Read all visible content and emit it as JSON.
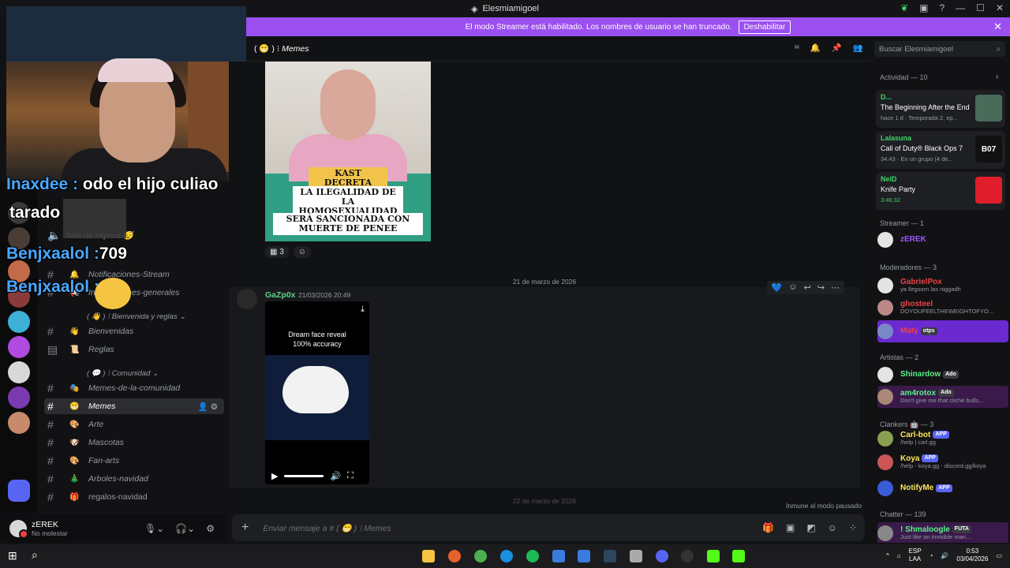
{
  "window": {
    "title": "Elesmiamigoel"
  },
  "streamer_banner": {
    "text": "El modo Streamer está habilitado. Los nombres de usuario se han truncado.",
    "button": "Deshabilitar"
  },
  "overlay_chat": [
    {
      "user": "Inaxdee :",
      "msg": "odo el hijo culiao"
    },
    {
      "user": "",
      "msg": "tarado"
    },
    {
      "user": "Benjxaalol :",
      "msg": "709"
    },
    {
      "user": "Benjxaalol :",
      "msg": ""
    }
  ],
  "channels": {
    "partial": [
      {
        "label": "Sala de espera 😴"
      },
      {
        "label": "Notificaciones-Stream",
        "emoji": "🔔"
      },
      {
        "label": "Informaciones-generales",
        "emoji": "📢"
      }
    ],
    "categories": [
      {
        "label": "Bienvenida y reglas",
        "emoji": "👋"
      },
      {
        "label": "Comunidad",
        "emoji": "💬"
      }
    ],
    "items": [
      {
        "label": "Bienvenidas",
        "emoji": "👋"
      },
      {
        "label": "Reglas",
        "emoji": "📜"
      },
      {
        "label": "Memes-de-la-comunidad",
        "emoji": "🎭"
      },
      {
        "label": "Memes",
        "emoji": "😁"
      },
      {
        "label": "Arte",
        "emoji": "🎨"
      },
      {
        "label": "Mascotas",
        "emoji": "🐶"
      },
      {
        "label": "Fan-arts",
        "emoji": "🎨"
      },
      {
        "label": "Arboles-navidad",
        "emoji": "🎄"
      },
      {
        "label": "regalos-navidad",
        "emoji": "🎁"
      }
    ]
  },
  "user_panel": {
    "name": "zEREK",
    "status": "No molestar"
  },
  "channel_header": {
    "name": "Memes",
    "emoji": "😁"
  },
  "search": {
    "placeholder": "Buscar Elesmiamigoel"
  },
  "chat": {
    "meme": {
      "line1": "KAST DECRETA",
      "line2": "LA ILEGALIDAD DE LA HOMOSEXUALIDAD",
      "line3": "SERÁ SANCIONADA CON MUERTE DE PENEE"
    },
    "reaction": {
      "count": "3"
    },
    "date_divider": "21 de marzo de 2026",
    "date_divider2": "22 de marzo de 2026",
    "message": {
      "author": "GaZp0x",
      "timestamp": "21/03/2026 20:49",
      "video_title_1": "Dream face reveal",
      "video_title_2": "100% accuracy"
    },
    "paused": "Inmune al modo pausado"
  },
  "composer": {
    "placeholder": "Enviar mensaje a # ( 😁 ) ⁝ Memes"
  },
  "members": {
    "activity_header": "Actividad — 10",
    "activities": [
      {
        "user": "D...",
        "game": "The Beginning After the End",
        "sub": "hace 1 d · Temporada 2, ep..."
      },
      {
        "user": "Lalasuna",
        "game": "Call of Duty® Black Ops 7",
        "sub": "34:43 · En un grupo (4 de..."
      },
      {
        "user": "NelD",
        "game": "Knife Party",
        "sub": "3:46:32"
      }
    ],
    "sections": [
      {
        "title": "Streamer — 1"
      },
      {
        "title": "Moderadores — 3"
      },
      {
        "title": "Artistas — 2"
      },
      {
        "title": "Clankers 🤖 — 3"
      },
      {
        "title": "Chatter — 139"
      }
    ],
    "list": [
      {
        "name": "zEREK",
        "status": "",
        "tag": "",
        "color": "#9b59ff"
      },
      {
        "name": "GabrielPox",
        "status": "ya llegsorn las niggadh",
        "tag": "",
        "color": "#ed4245"
      },
      {
        "name": "ghosteel",
        "status": "DOYOUFEELTHEWEIGHTOFYO...",
        "tag": "",
        "color": "#ed4245"
      },
      {
        "name": "Maty",
        "status": "",
        "tag": "otps",
        "color": "#ed4245"
      },
      {
        "name": "Shinardow",
        "status": "",
        "tag": "Ado",
        "color": "#57f287"
      },
      {
        "name": "am4rotox",
        "status": "Don't give me that cliché bulls...",
        "tag": "Ado",
        "color": "#57f287"
      },
      {
        "name": "Carl-bot",
        "status": "/help | carl.gg",
        "tag": "APP",
        "color": "#fee75c"
      },
      {
        "name": "Koya",
        "status": "/help - koya.gg - discord.gg/koya",
        "tag": "APP",
        "color": "#fee75c"
      },
      {
        "name": "NotifyMe",
        "status": "",
        "tag": "APP",
        "color": "#fee75c"
      },
      {
        "name": "! Shmaloogle",
        "status": "Just like an invisible man...",
        "tag": "FUTA",
        "color": "#57f287"
      }
    ]
  },
  "taskbar": {
    "lang1": "ESP",
    "lang2": "LAA",
    "time": "0:53",
    "date": "03/04/2026"
  }
}
